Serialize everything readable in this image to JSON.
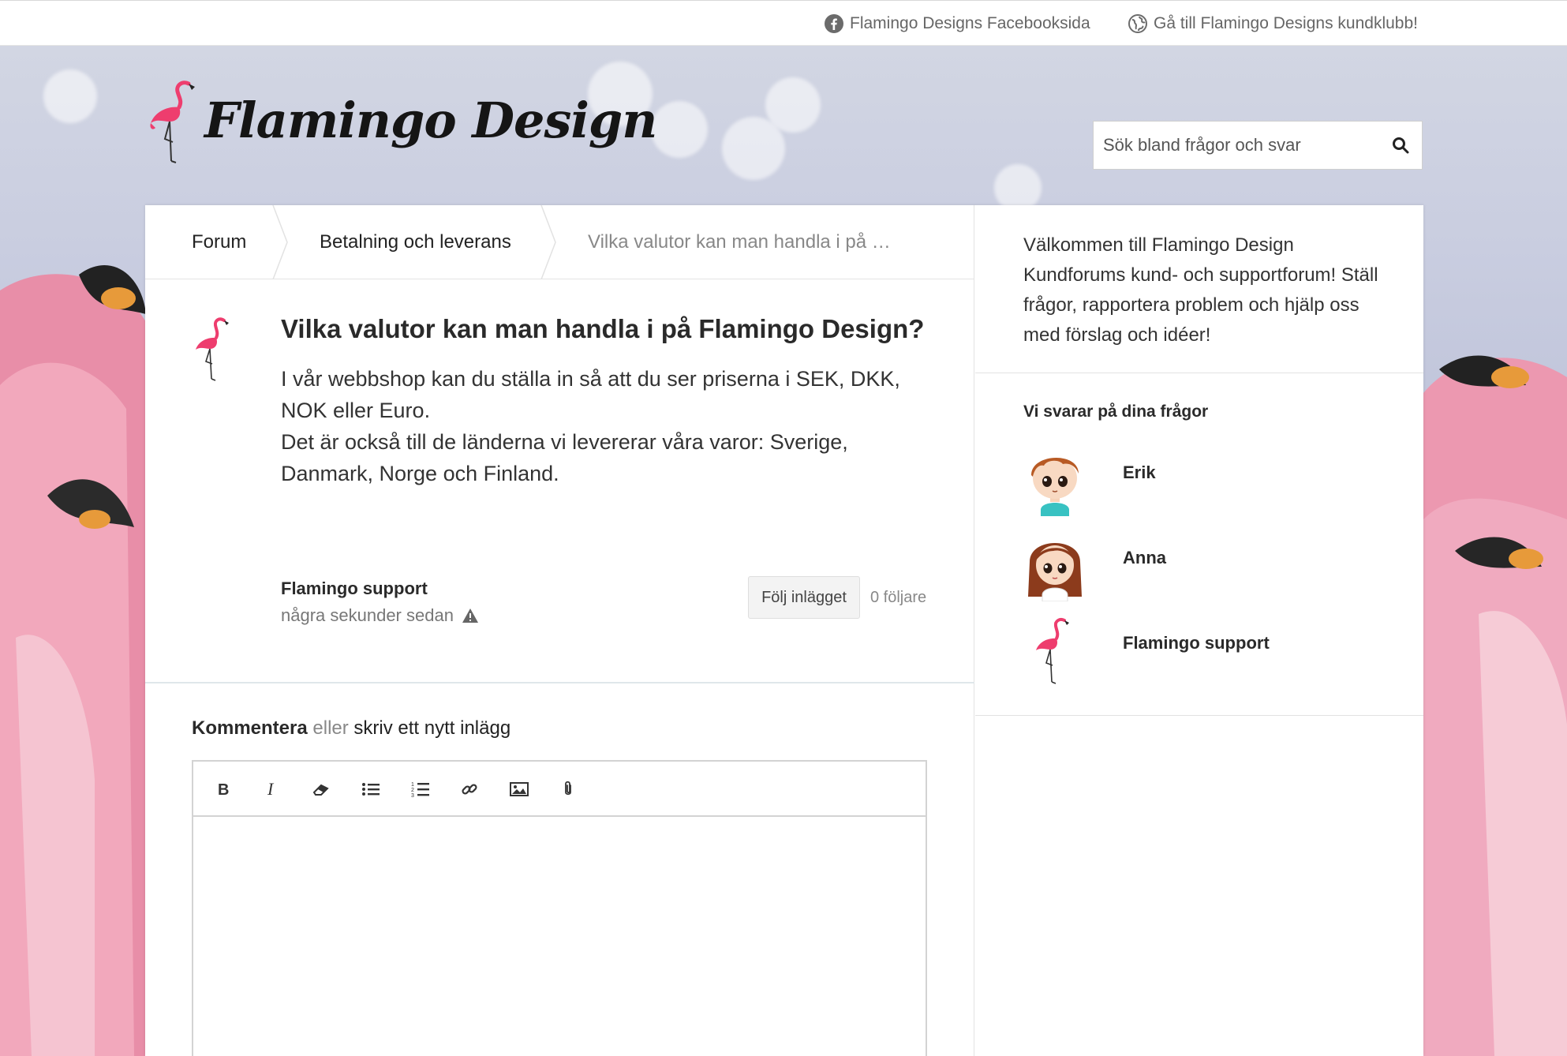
{
  "topbar": {
    "facebook_link": "Flamingo Designs Facebooksida",
    "club_link": "Gå till Flamingo Designs kundklubb!"
  },
  "brand": {
    "logo_text": "Flamingo Design",
    "accent_color": "#ee3d6e"
  },
  "search": {
    "placeholder": "Sök bland frågor och svar"
  },
  "breadcrumb": {
    "items": [
      "Forum",
      "Betalning och leverans",
      "Vilka valutor kan man handla i på …"
    ]
  },
  "post": {
    "title": "Vilka valutor kan man handla i på Flamingo Design?",
    "body": [
      "I vår webbshop kan du ställa in så att du ser priserna i SEK, DKK, NOK eller Euro.",
      "Det är också till de länderna vi levererar våra varor: Sverige, Danmark, Norge och Finland."
    ],
    "author": "Flamingo support",
    "time": "några sekunder sedan",
    "follow_label": "Följ inlägget",
    "followers": "0 följare"
  },
  "comment": {
    "comment_label": "Kommentera",
    "or_label": "eller",
    "new_post_label": "skriv ett nytt inlägg",
    "toolbar": [
      "bold-icon",
      "italic-icon",
      "eraser-icon",
      "bullet-list-icon",
      "numbered-list-icon",
      "link-icon",
      "image-icon",
      "attachment-icon"
    ]
  },
  "sidebar": {
    "welcome": "Välkommen till Flamingo Design Kundforums kund- och supportforum! Ställ frågor, rapportera problem och hjälp oss med förslag och idéer!",
    "answer_heading": "Vi svarar på dina frågor",
    "members": [
      {
        "name": "Erik"
      },
      {
        "name": "Anna"
      },
      {
        "name": "Flamingo support"
      }
    ]
  }
}
